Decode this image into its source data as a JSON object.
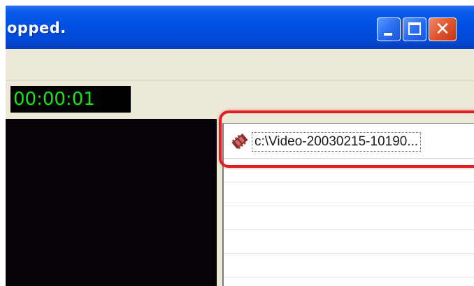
{
  "window": {
    "title": "opped.",
    "buttons": {
      "minimize": "minimize",
      "maximize": "maximize",
      "close": "close"
    }
  },
  "toolbar": {
    "timer": "00:00:01"
  },
  "file_list": {
    "items": [
      {
        "name": "c:\\Video-20030215-10190...",
        "icon": "film-reel-icon",
        "selected": true
      }
    ]
  },
  "colors": {
    "titlebar_blue": "#0050e3",
    "timer_green": "#13e613",
    "highlight_red": "#e01f24",
    "preview_black": "#070208"
  }
}
